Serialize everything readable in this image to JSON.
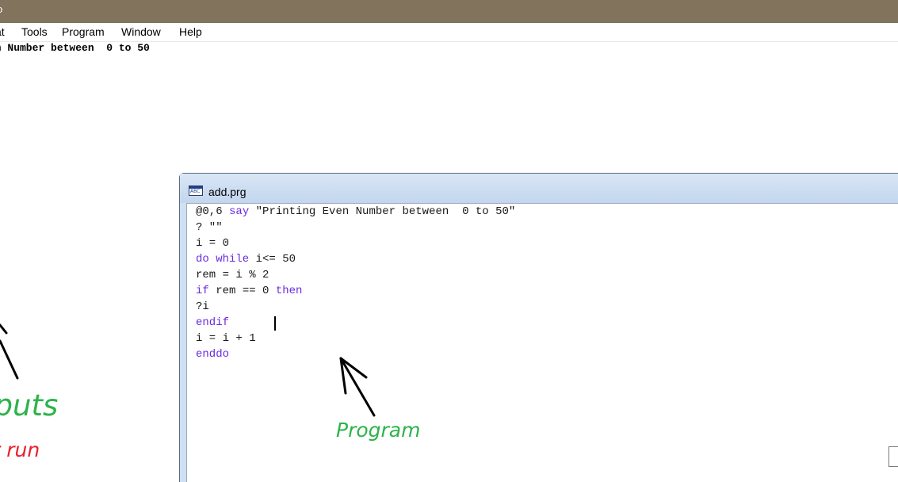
{
  "app": {
    "titlebar_glyph": "o"
  },
  "menubar": {
    "items": [
      {
        "id": "format",
        "label": "at"
      },
      {
        "id": "tools",
        "label": "Tools"
      },
      {
        "id": "program",
        "label": "Program"
      },
      {
        "id": "window",
        "label": "Window"
      },
      {
        "id": "help",
        "label": "Help"
      }
    ]
  },
  "output_screen": {
    "line": "en Number between  0 to 50"
  },
  "editor": {
    "title": "add.prg",
    "icon": "text-document-icon",
    "icon_text": "ABC",
    "code": [
      {
        "parts": [
          {
            "t": "@0,6 ",
            "k": false
          },
          {
            "t": "say",
            "k": true
          },
          {
            "t": " \"Printing Even Number between  0 to 50\"",
            "k": false
          }
        ]
      },
      {
        "parts": [
          {
            "t": "? \"\"",
            "k": false
          }
        ]
      },
      {
        "parts": [
          {
            "t": "i = 0",
            "k": false
          }
        ]
      },
      {
        "parts": [
          {
            "t": "do while",
            "k": true
          },
          {
            "t": " i<= 50",
            "k": false
          }
        ]
      },
      {
        "parts": [
          {
            "t": "rem = i % 2",
            "k": false
          }
        ]
      },
      {
        "parts": [
          {
            "t": "if",
            "k": true
          },
          {
            "t": " rem == 0 ",
            "k": false
          },
          {
            "t": "then",
            "k": true
          }
        ]
      },
      {
        "parts": [
          {
            "t": "?i",
            "k": false
          }
        ]
      },
      {
        "parts": [
          {
            "t": "endif",
            "k": true
          }
        ]
      },
      {
        "parts": [
          {
            "t": "i = i + 1",
            "k": false
          }
        ]
      },
      {
        "parts": [
          {
            "t": "enddo",
            "k": true
          }
        ]
      }
    ]
  },
  "annotations": {
    "outputs_label": "tputs",
    "run_label": "r run",
    "program_label": "Program"
  },
  "colors": {
    "titlebar": "#81735c",
    "keyword": "#6b2be0",
    "annotation_green": "#2db34a",
    "annotation_red": "#e8202a"
  }
}
